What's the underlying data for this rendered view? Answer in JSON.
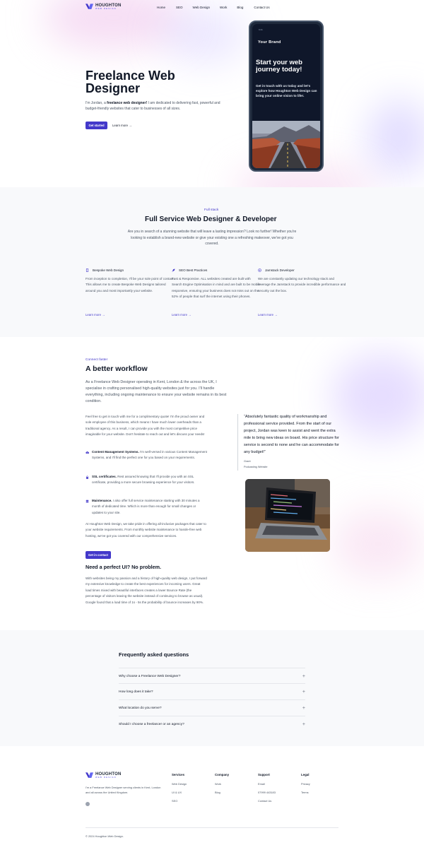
{
  "brand": {
    "name": "HOUGHTON",
    "tagline": "WEB DESIGN"
  },
  "nav": [
    "Home",
    "SEO",
    "Web Design",
    "Work",
    "Blog",
    "Contact Us"
  ],
  "hero": {
    "title": "Freelance Web Designer",
    "desc_before": "I'm Jordan, a ",
    "desc_bold": "freelance web designer!",
    "desc_after": " I am dedicated to delivering fast, powerful and budget-friendly websites that cater to businesses of all sizes.",
    "cta": "Get started",
    "learn_more": "Learn more →"
  },
  "phone": {
    "status": "9:41",
    "brand": "Your Brand",
    "headline": "Start your web journey today!",
    "body": "Get in touch with us today and let's explore how Houghton Web Design can bring your online vision to life!."
  },
  "services": {
    "eyebrow": "Full stack",
    "title": "Full Service Web Designer & Developer",
    "desc": "Are you in search of a stunning website that will leave a lasting impression? Look no further! Whether you're looking to establish a brand-new website or give your existing one a refreshing makeover, we've got you covered.",
    "cards": [
      {
        "icon": "mobile-icon",
        "title": "Bespoke Web Design",
        "body": "From inception to completion, I'll be your sole point of contact. This allows me to create Bespoke Web Designs tailored around you and most importantly your website.",
        "link": "Learn more →"
      },
      {
        "icon": "rocket-icon",
        "title": "SEO Best Practices",
        "body": "Fast & Responsive. ALL websites created are built with Search Engine Optimisation in mind and are built to be mobile responsive, ensuring your business does not miss out on the 52% of people that surf the internet using their phones.",
        "link": "Learn more →"
      },
      {
        "icon": "sparkle-icon",
        "title": "Jamstack Developer",
        "body": "We are constantly updating our technology stack and leverage the Jamstack to provide incredible performance and security out the box.",
        "link": "Learn more →"
      }
    ]
  },
  "workflow": {
    "eyebrow": "Connect faster",
    "title": "A better workflow",
    "lead": "As a Freelance Web Designer operating in Kent, London & the across the UK, I specialise in crafting personalised high-quality websites just for you. I'll handle everything, including ongoing maintenance to ensure your website remains in its best condition.",
    "p1": "Feel free to get in touch with me for a complimentary quote! I'm the proud owner and sole employee of this business, which means I have much lower overheads than a traditional agency. As a result, I can provide you with the most competitive price imaginable for your website. Don't hesitate to reach out and let's discuss your needs!",
    "features": [
      {
        "icon": "cloud-upload-icon",
        "title": "Content Management Systems.",
        "text": " I'm well-versed in various Content Management Systems, and I'll find the perfect one for you based on your requirements."
      },
      {
        "icon": "lock-icon",
        "title": "SSL certificates.",
        "text": " Rest assured knowing that I'll provide you with an SSL certificate, providing a more secure browsing experience for your visitors."
      },
      {
        "icon": "server-icon",
        "title": "Maintenance.",
        "text": " I also offer full service maintenance starting with 30 minutes a month of dedicated time. Which is more than enough for small changes or updates to your site."
      }
    ],
    "p2": "At Houghton Web Design, we take pride in offering all-inclusive packages that cater to your website requirements. From monthly website maintenance to hassle-free web hosting, we've got you covered with our comprehensive services.",
    "cta": "Get in contact",
    "sub_title": "Need a perfect UI? No problem.",
    "p3": "With websites being my passion and a history of high-quality web design, I put forward my extensive knowledge to create the best experiences for incoming users. Great load times mixed with beautiful interfaces creates a lower Bounce Rate (the percentage of visitors leaving the website instead of continuing to browse as usual). Google found that a load time of 1s - 5s the probability of bounce increases by 90%."
  },
  "testimonial": {
    "quote": "“Absolutely fantastic quality of workmanship and professional service provided. From the start of our project, Jordan was keen to assist and went the extra mile to bring new ideas on board. His price structure for service is second to none and he can accommodate for any budget!”",
    "name": "Grant",
    "role": "Podcasting Website"
  },
  "faq": {
    "title": "Frequently asked questions",
    "items": [
      "Why choose a Freelance Web Designer?",
      "How long does it take?",
      "What location do you serve?",
      "Should I choose a freelancer or an agency?"
    ]
  },
  "footer": {
    "desc": "I'm a Freelance Web Designer serving clients in Kent, London and all across the United Kingdom.",
    "columns": [
      {
        "title": "Services",
        "links": [
          "Web Design",
          "UI & UX",
          "SEO"
        ]
      },
      {
        "title": "Company",
        "links": [
          "Work",
          "Blog"
        ]
      },
      {
        "title": "Support",
        "links": [
          "Email",
          "07999 443183",
          "Contact Us"
        ]
      },
      {
        "title": "Legal",
        "links": [
          "Privacy",
          "Terms"
        ]
      }
    ],
    "copyright": "© 2024 Houghton Web Design."
  }
}
